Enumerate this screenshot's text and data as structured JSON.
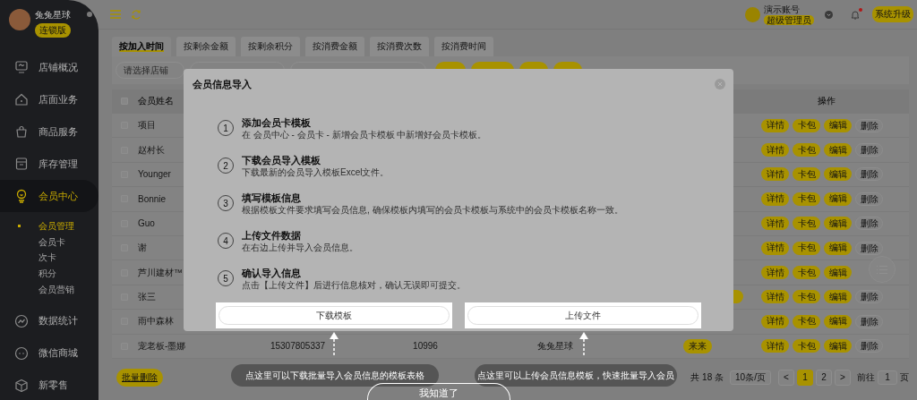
{
  "sidebar": {
    "user": {
      "name": "兔兔星球",
      "badge": "连锁版"
    },
    "items": [
      {
        "label": "店铺概况",
        "kind": "monitor",
        "selected": false
      },
      {
        "label": "店面业务",
        "kind": "house",
        "selected": false
      },
      {
        "label": "商品服务",
        "kind": "bag",
        "selected": false
      },
      {
        "label": "库存管理",
        "kind": "box",
        "selected": false
      },
      {
        "label": "会员中心",
        "kind": "member",
        "selected": true,
        "children": [
          {
            "label": "会员管理",
            "selected": true
          },
          {
            "label": "会员卡",
            "selected": false
          },
          {
            "label": "次卡",
            "selected": false
          },
          {
            "label": "积分",
            "selected": false
          },
          {
            "label": "会员营销",
            "selected": false
          }
        ]
      },
      {
        "label": "数据统计",
        "kind": "chart",
        "selected": false
      },
      {
        "label": "微信商城",
        "kind": "chat",
        "selected": false
      },
      {
        "label": "新零售",
        "kind": "cube",
        "selected": false
      }
    ]
  },
  "topbar": {
    "account": "演示账号",
    "role": "超级管理员",
    "notification": true,
    "upgrade": "系统升级"
  },
  "tabs": [
    {
      "label": "按加入时间",
      "selected": true
    },
    {
      "label": "按剩余金额",
      "selected": false
    },
    {
      "label": "按剩余积分",
      "selected": false
    },
    {
      "label": "按消费金额",
      "selected": false
    },
    {
      "label": "按消费次数",
      "selected": false
    },
    {
      "label": "按消费时间",
      "selected": false
    }
  ],
  "filters": {
    "store_placeholder": "请选择店铺"
  },
  "table": {
    "columns": [
      "会员姓名",
      "操作"
    ],
    "all_checked": false,
    "rows": [
      {
        "name": "项目",
        "checked": false,
        "actions": [
          "详情",
          "卡包",
          "编辑",
          "删除"
        ]
      },
      {
        "name": "赵村长",
        "checked": false,
        "actions": [
          "详情",
          "卡包",
          "编辑",
          "删除"
        ]
      },
      {
        "name": "Younger",
        "checked": false,
        "actions": [
          "详情",
          "卡包",
          "编辑",
          "删除"
        ]
      },
      {
        "name": "Bonnie",
        "checked": false,
        "actions": [
          "详情",
          "卡包",
          "编辑",
          "删除"
        ]
      },
      {
        "name": "Guo",
        "checked": false,
        "actions": [
          "详情",
          "卡包",
          "编辑",
          "删除"
        ]
      },
      {
        "name": "谢",
        "checked": false,
        "actions": [
          "详情",
          "卡包",
          "编辑",
          "删除"
        ]
      },
      {
        "name": "芦川建材™",
        "checked": false,
        "actions": [
          "详情",
          "卡包",
          "编辑"
        ]
      },
      {
        "name": "张三",
        "checked": false,
        "column_7_tag": true,
        "actions": [
          "详情",
          "卡包",
          "编辑",
          "删除"
        ]
      },
      {
        "name": "雨中森林",
        "checked": false,
        "actions": [
          "详情",
          "卡包",
          "编辑",
          "删除"
        ]
      },
      {
        "name": "宠老板-墨娜",
        "checked": false,
        "phone": "15307805337",
        "points": "10996",
        "store": "兔兔星球",
        "tag": "来来",
        "actions": [
          "详情",
          "卡包",
          "编辑",
          "删除"
        ]
      }
    ]
  },
  "bulk_delete": "批量删除",
  "pagination": {
    "total": "共 18 条",
    "page_size": "10条/页",
    "prev": "<",
    "next": ">",
    "pages": [
      {
        "label": "1",
        "selected": true
      },
      {
        "label": "2",
        "selected": false
      }
    ],
    "goto_label": "前往",
    "goto_value": "1",
    "page_suffix": "页"
  },
  "modal": {
    "title": "会员信息导入",
    "steps": [
      {
        "number": "1",
        "title": "添加会员卡模板",
        "desc": "在 会员中心 - 会员卡 - 新增会员卡模板 中新增好会员卡模板。"
      },
      {
        "number": "2",
        "title": "下载会员导入模板",
        "desc": "下载最新的会员导入模板Excel文件。"
      },
      {
        "number": "3",
        "title": "填写模板信息",
        "desc": "根据模板文件要求填写会员信息, 确保模板内填写的会员卡模板与系统中的会员卡模板名称一致。"
      },
      {
        "number": "4",
        "title": "上传文件数据",
        "desc": "在右边上传并导入会员信息。"
      },
      {
        "number": "5",
        "title": "确认导入信息",
        "desc": "点击【上传文件】后进行信息核对，确认无误即可提交。"
      }
    ],
    "buttons": [
      "下载模板",
      "上传文件"
    ]
  },
  "guide": {
    "tips": [
      "点这里可以下载批量导入会员信息的模板表格",
      "点这里可以上传会员信息模板，快速批量导入会员"
    ],
    "confirm": "我知道了"
  }
}
